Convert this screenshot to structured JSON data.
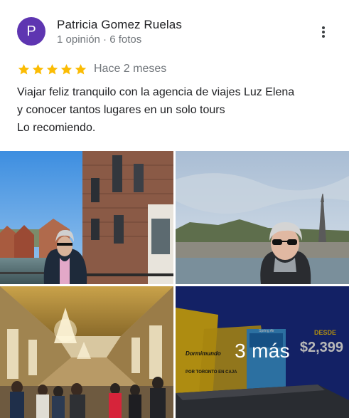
{
  "review": {
    "author": {
      "initial": "P",
      "name": "Patricia Gomez Ruelas",
      "stats": "1 opinión · 6 fotos",
      "avatar_color": "#5e35b1"
    },
    "rating": {
      "stars": 5,
      "max": 5,
      "star_color": "#fbbc04"
    },
    "time": "Hace 2 meses",
    "text_lines": [
      "Viajar feliz tranquilo con la agencia de viajes Luz Elena",
      "y conocer tantos lugares en un solo tours",
      "Lo recomiendo."
    ],
    "more_icon": "more-vert-icon"
  },
  "photos": {
    "items": [
      {
        "name": "bruges-canal-photo"
      },
      {
        "name": "paris-eiffel-photo"
      },
      {
        "name": "versailles-hall-of-mirrors-photo"
      },
      {
        "name": "mattress-ad-photo",
        "ad_text": {
          "desde": "DESDE",
          "price": "$2,399",
          "brand": "Dormimundo",
          "caption": "POR TORONTO EN CAJA",
          "box_brand": "Spring Air"
        }
      }
    ],
    "more_label": "3 más"
  }
}
